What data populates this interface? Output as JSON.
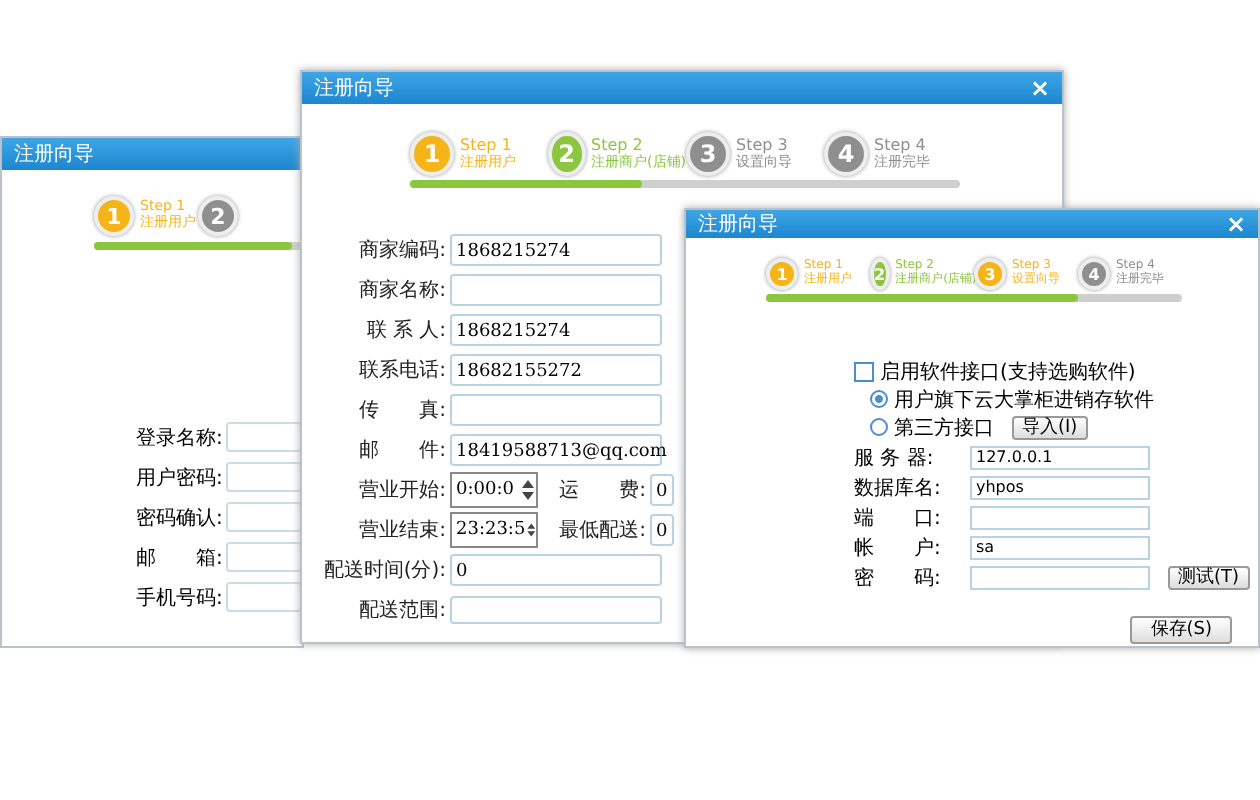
{
  "windows": [
    {
      "title": "注册向导",
      "progress": {
        "level": 0.62
      },
      "steps": [
        {
          "number": "1",
          "title": "Step 1",
          "label": "注册用户",
          "color": "#f5b417"
        },
        {
          "number": "2",
          "color": "#8f8f8f"
        }
      ],
      "fields": [
        {
          "label": "登录名称:"
        },
        {
          "label": "用户密码:"
        },
        {
          "label": "密码确认:"
        },
        {
          "label": "邮　　箱:"
        },
        {
          "label": "手机号码:"
        }
      ]
    },
    {
      "title": "注册向导",
      "close": "×",
      "progress": {
        "level": 0.42
      },
      "steps": [
        {
          "number": "1",
          "title": "Step 1",
          "label": "注册用户",
          "color": "#f5b417"
        },
        {
          "number": "2",
          "title": "Step 2",
          "label": "注册商户(店铺)",
          "color": "#8cc63f"
        },
        {
          "number": "3",
          "title": "Step 3",
          "label": "设置向导",
          "color": "#8f8f8f"
        },
        {
          "number": "4",
          "title": "Step 4",
          "label": "注册完毕",
          "color": "#8f8f8f"
        }
      ],
      "fields": [
        {
          "kind": "text",
          "label": "商家编码:",
          "value": "1868215274"
        },
        {
          "kind": "text",
          "label": "商家名称:"
        },
        {
          "kind": "text",
          "label": "联 系 人:",
          "value": "1868215274"
        },
        {
          "kind": "text",
          "label": "联系电话:",
          "value": "18682155272"
        },
        {
          "kind": "text",
          "label": "传　　真:"
        },
        {
          "kind": "text",
          "label": "邮　　件:",
          "value": "18419588713@qq.com"
        },
        {
          "kind": "spin",
          "label": "营业开始:",
          "value": "0:00:0",
          "side_label": "运　　费:",
          "side_value": "0"
        },
        {
          "kind": "spin",
          "label": "营业结束:",
          "value": "23:23:5",
          "side_label": "最低配送:",
          "side_value": "0"
        },
        {
          "kind": "text",
          "label": "配送时间(分):",
          "value": "0"
        },
        {
          "kind": "area",
          "label": "配送范围:"
        }
      ]
    },
    {
      "title": "注册向导",
      "close": "×",
      "progress": {
        "level": 0.75
      },
      "steps": [
        {
          "number": "1",
          "title": "Step 1",
          "label": "注册用户",
          "color": "#f5b417"
        },
        {
          "number": "2",
          "title": "Step 2",
          "label": "注册商户(店铺)",
          "color": "#8cc63f"
        },
        {
          "number": "3",
          "title": "Step 3",
          "label": "设置向导",
          "color": "#f5b417"
        },
        {
          "number": "4",
          "title": "Step 4",
          "label": "注册完毕",
          "color": "#8f8f8f"
        }
      ],
      "enable_interface": {
        "label": "启用软件接口(支持选购软件)",
        "checked": false
      },
      "options": [
        {
          "label": "用户旗下云大掌柜进销存软件",
          "selected": true
        },
        {
          "label": "第三方接口",
          "selected": false,
          "button": "导入(I)"
        }
      ],
      "fields": [
        {
          "label": "服 务 器:",
          "value": "127.0.0.1"
        },
        {
          "label": "数据库名:",
          "value": "yhpos"
        },
        {
          "label": "端　　口:"
        },
        {
          "label": "帐　　户:",
          "value": "sa"
        },
        {
          "label": "密　　码:",
          "button": "测试(T)"
        }
      ],
      "save_button": "保存(S)"
    }
  ]
}
